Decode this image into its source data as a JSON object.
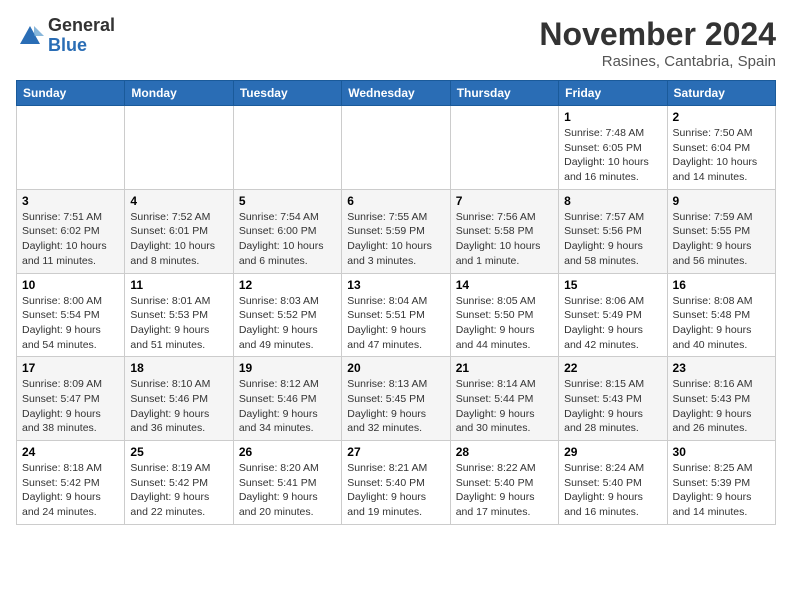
{
  "logo": {
    "general": "General",
    "blue": "Blue"
  },
  "title": "November 2024",
  "subtitle": "Rasines, Cantabria, Spain",
  "headers": [
    "Sunday",
    "Monday",
    "Tuesday",
    "Wednesday",
    "Thursday",
    "Friday",
    "Saturday"
  ],
  "weeks": [
    [
      {
        "day": "",
        "info": ""
      },
      {
        "day": "",
        "info": ""
      },
      {
        "day": "",
        "info": ""
      },
      {
        "day": "",
        "info": ""
      },
      {
        "day": "",
        "info": ""
      },
      {
        "day": "1",
        "info": "Sunrise: 7:48 AM\nSunset: 6:05 PM\nDaylight: 10 hours and 16 minutes."
      },
      {
        "day": "2",
        "info": "Sunrise: 7:50 AM\nSunset: 6:04 PM\nDaylight: 10 hours and 14 minutes."
      }
    ],
    [
      {
        "day": "3",
        "info": "Sunrise: 7:51 AM\nSunset: 6:02 PM\nDaylight: 10 hours and 11 minutes."
      },
      {
        "day": "4",
        "info": "Sunrise: 7:52 AM\nSunset: 6:01 PM\nDaylight: 10 hours and 8 minutes."
      },
      {
        "day": "5",
        "info": "Sunrise: 7:54 AM\nSunset: 6:00 PM\nDaylight: 10 hours and 6 minutes."
      },
      {
        "day": "6",
        "info": "Sunrise: 7:55 AM\nSunset: 5:59 PM\nDaylight: 10 hours and 3 minutes."
      },
      {
        "day": "7",
        "info": "Sunrise: 7:56 AM\nSunset: 5:58 PM\nDaylight: 10 hours and 1 minute."
      },
      {
        "day": "8",
        "info": "Sunrise: 7:57 AM\nSunset: 5:56 PM\nDaylight: 9 hours and 58 minutes."
      },
      {
        "day": "9",
        "info": "Sunrise: 7:59 AM\nSunset: 5:55 PM\nDaylight: 9 hours and 56 minutes."
      }
    ],
    [
      {
        "day": "10",
        "info": "Sunrise: 8:00 AM\nSunset: 5:54 PM\nDaylight: 9 hours and 54 minutes."
      },
      {
        "day": "11",
        "info": "Sunrise: 8:01 AM\nSunset: 5:53 PM\nDaylight: 9 hours and 51 minutes."
      },
      {
        "day": "12",
        "info": "Sunrise: 8:03 AM\nSunset: 5:52 PM\nDaylight: 9 hours and 49 minutes."
      },
      {
        "day": "13",
        "info": "Sunrise: 8:04 AM\nSunset: 5:51 PM\nDaylight: 9 hours and 47 minutes."
      },
      {
        "day": "14",
        "info": "Sunrise: 8:05 AM\nSunset: 5:50 PM\nDaylight: 9 hours and 44 minutes."
      },
      {
        "day": "15",
        "info": "Sunrise: 8:06 AM\nSunset: 5:49 PM\nDaylight: 9 hours and 42 minutes."
      },
      {
        "day": "16",
        "info": "Sunrise: 8:08 AM\nSunset: 5:48 PM\nDaylight: 9 hours and 40 minutes."
      }
    ],
    [
      {
        "day": "17",
        "info": "Sunrise: 8:09 AM\nSunset: 5:47 PM\nDaylight: 9 hours and 38 minutes."
      },
      {
        "day": "18",
        "info": "Sunrise: 8:10 AM\nSunset: 5:46 PM\nDaylight: 9 hours and 36 minutes."
      },
      {
        "day": "19",
        "info": "Sunrise: 8:12 AM\nSunset: 5:46 PM\nDaylight: 9 hours and 34 minutes."
      },
      {
        "day": "20",
        "info": "Sunrise: 8:13 AM\nSunset: 5:45 PM\nDaylight: 9 hours and 32 minutes."
      },
      {
        "day": "21",
        "info": "Sunrise: 8:14 AM\nSunset: 5:44 PM\nDaylight: 9 hours and 30 minutes."
      },
      {
        "day": "22",
        "info": "Sunrise: 8:15 AM\nSunset: 5:43 PM\nDaylight: 9 hours and 28 minutes."
      },
      {
        "day": "23",
        "info": "Sunrise: 8:16 AM\nSunset: 5:43 PM\nDaylight: 9 hours and 26 minutes."
      }
    ],
    [
      {
        "day": "24",
        "info": "Sunrise: 8:18 AM\nSunset: 5:42 PM\nDaylight: 9 hours and 24 minutes."
      },
      {
        "day": "25",
        "info": "Sunrise: 8:19 AM\nSunset: 5:42 PM\nDaylight: 9 hours and 22 minutes."
      },
      {
        "day": "26",
        "info": "Sunrise: 8:20 AM\nSunset: 5:41 PM\nDaylight: 9 hours and 20 minutes."
      },
      {
        "day": "27",
        "info": "Sunrise: 8:21 AM\nSunset: 5:40 PM\nDaylight: 9 hours and 19 minutes."
      },
      {
        "day": "28",
        "info": "Sunrise: 8:22 AM\nSunset: 5:40 PM\nDaylight: 9 hours and 17 minutes."
      },
      {
        "day": "29",
        "info": "Sunrise: 8:24 AM\nSunset: 5:40 PM\nDaylight: 9 hours and 16 minutes."
      },
      {
        "day": "30",
        "info": "Sunrise: 8:25 AM\nSunset: 5:39 PM\nDaylight: 9 hours and 14 minutes."
      }
    ]
  ]
}
